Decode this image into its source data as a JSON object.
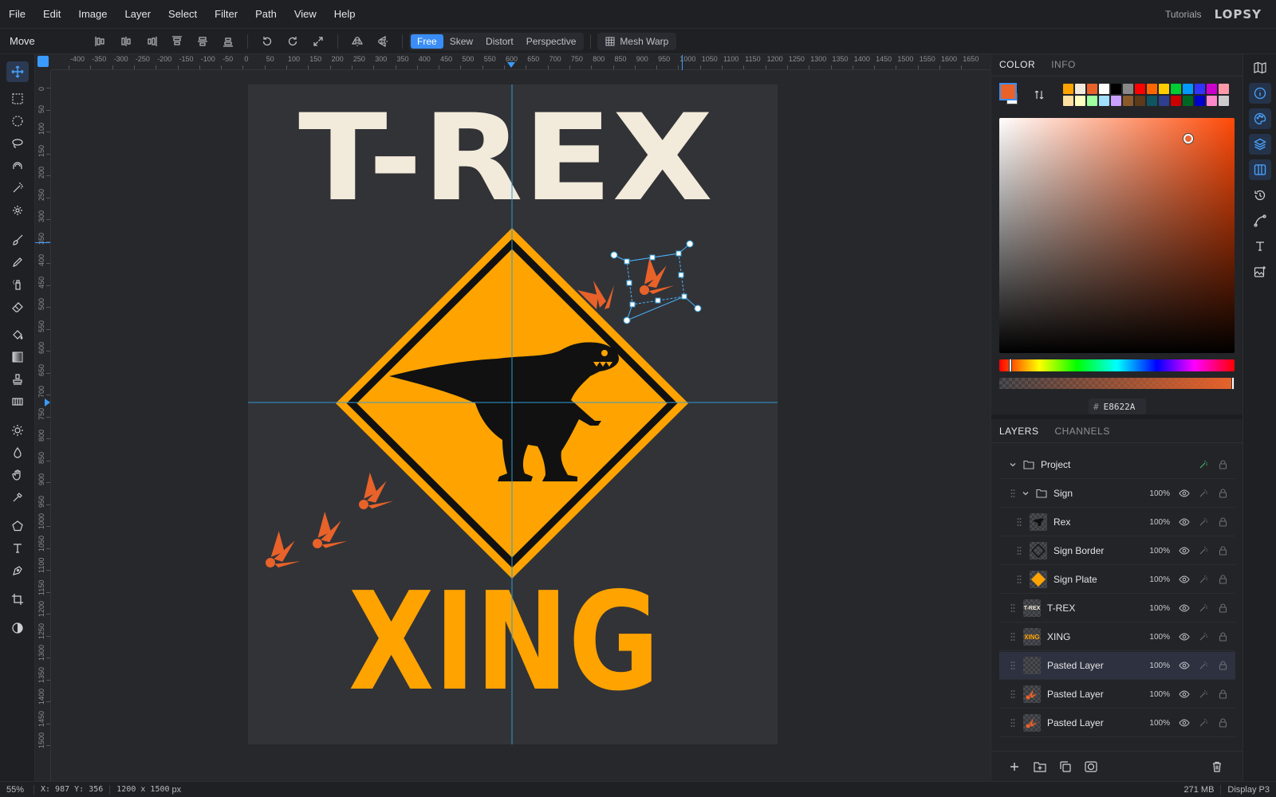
{
  "menu": [
    "File",
    "Edit",
    "Image",
    "Layer",
    "Select",
    "Filter",
    "Path",
    "View",
    "Help"
  ],
  "header": {
    "tutorials": "Tutorials",
    "logo": "LOPSY"
  },
  "options": {
    "tool_name": "Move",
    "transform_modes": [
      "Free",
      "Skew",
      "Distort",
      "Perspective"
    ],
    "active_mode": "Free",
    "mesh_warp": "Mesh Warp"
  },
  "ruler": {
    "top_labels": [
      "-400",
      "-350",
      "-300",
      "-250",
      "-200",
      "-150",
      "-100",
      "-50",
      "0",
      "50",
      "100",
      "150",
      "200",
      "250",
      "300",
      "350",
      "400",
      "450",
      "500",
      "550",
      "600",
      "650",
      "700",
      "750",
      "800",
      "850",
      "900",
      "950",
      "1000",
      "1050",
      "1100",
      "1150",
      "1200",
      "1250",
      "1300",
      "1350",
      "1400",
      "1450",
      "1500",
      "1550",
      "1600",
      "1650"
    ],
    "left_labels": [
      "0",
      "50",
      "100",
      "150",
      "200",
      "250",
      "300",
      "350",
      "400",
      "450",
      "500",
      "550",
      "600",
      "650",
      "700",
      "750",
      "800",
      "850",
      "900",
      "950",
      "1000",
      "1050",
      "1100",
      "1150",
      "1200",
      "1250",
      "1300",
      "1350",
      "1400",
      "1450",
      "1500"
    ]
  },
  "artwork": {
    "title_text": "T-REX",
    "subtitle_text": "XING",
    "accent_color": "#FFA300",
    "text_color": "#F2EADA",
    "track_color": "#E8622A"
  },
  "color_panel": {
    "tabs": [
      "COLOR",
      "INFO"
    ],
    "active_tab": "COLOR",
    "foreground": "#E8622A",
    "background": "#FFFFFF",
    "swatches": [
      "#FFA300",
      "#F2EADA",
      "#E8622A",
      "#FFFFFF",
      "#000000",
      "#888888",
      "#FF0000",
      "#FF6600",
      "#FFCC00",
      "#00CC33",
      "#0099FF",
      "#3333FF",
      "#CC00CC",
      "#FF99AA",
      "#FFE0A0",
      "#FFFFC0",
      "#A0FFA0",
      "#A0E0FF",
      "#C8A0FF",
      "#8B5A2B",
      "#5C3A1A",
      "#0F5560",
      "#2F3F8F",
      "#CC0000",
      "#006622",
      "#0000CC",
      "#FF88CC",
      "#CCCCCC"
    ],
    "hex_label": "#",
    "hex_value": "E8622A"
  },
  "layers_panel": {
    "tabs": [
      "LAYERS",
      "CHANNELS"
    ],
    "active_tab": "LAYERS",
    "layers": [
      {
        "name": "Project",
        "opacity": "",
        "group": true,
        "indent": 0
      },
      {
        "name": "Sign",
        "opacity": "100%",
        "group": true,
        "indent": 1
      },
      {
        "name": "Rex",
        "opacity": "100%",
        "group": false,
        "indent": 2
      },
      {
        "name": "Sign Border",
        "opacity": "100%",
        "group": false,
        "indent": 2
      },
      {
        "name": "Sign Plate",
        "opacity": "100%",
        "group": false,
        "indent": 2
      },
      {
        "name": "T-REX",
        "opacity": "100%",
        "group": false,
        "indent": 1
      },
      {
        "name": "XING",
        "opacity": "100%",
        "group": false,
        "indent": 1
      },
      {
        "name": "Pasted Layer",
        "opacity": "100%",
        "group": false,
        "indent": 1,
        "selected": true
      },
      {
        "name": "Pasted Layer",
        "opacity": "100%",
        "group": false,
        "indent": 1
      },
      {
        "name": "Pasted Layer",
        "opacity": "100%",
        "group": false,
        "indent": 1
      }
    ]
  },
  "status": {
    "zoom": "55%",
    "coords": "X: 987 Y: 356",
    "size": "1200 x 1500",
    "size_unit": "px",
    "memory": "271 MB",
    "profile": "Display P3"
  }
}
